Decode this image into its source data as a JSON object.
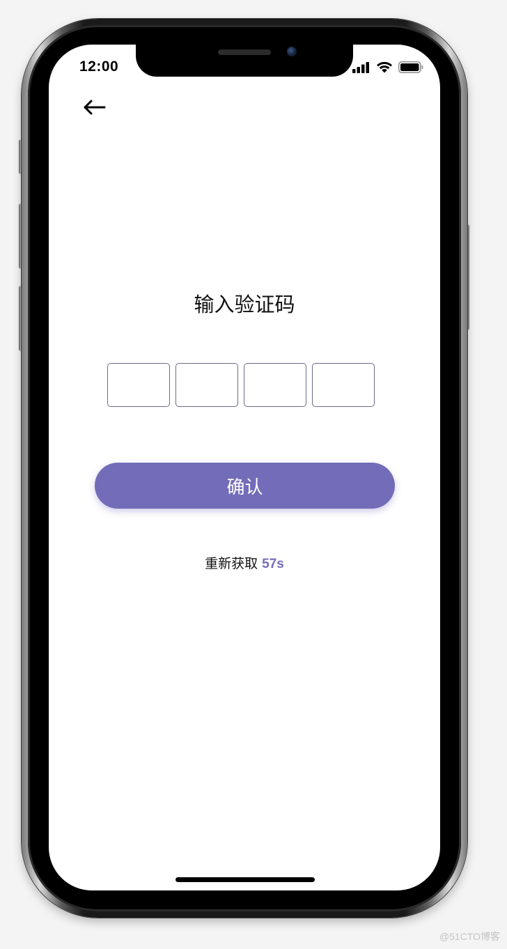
{
  "status_bar": {
    "time": "12:00",
    "signal_icon": "cellular-signal-icon",
    "wifi_icon": "wifi-icon",
    "battery_icon": "battery-icon"
  },
  "nav": {
    "back_icon": "arrow-left-icon"
  },
  "page": {
    "title": "输入验证码"
  },
  "code_input": {
    "values": [
      "",
      "",
      "",
      ""
    ]
  },
  "confirm_button": {
    "label": "确认"
  },
  "resend": {
    "label": "重新获取",
    "countdown": "57s"
  },
  "watermark": {
    "text": "@51CTO博客"
  },
  "colors": {
    "accent": "#736cb9",
    "box_border": "#6b6b8a",
    "background": "#ffffff"
  }
}
